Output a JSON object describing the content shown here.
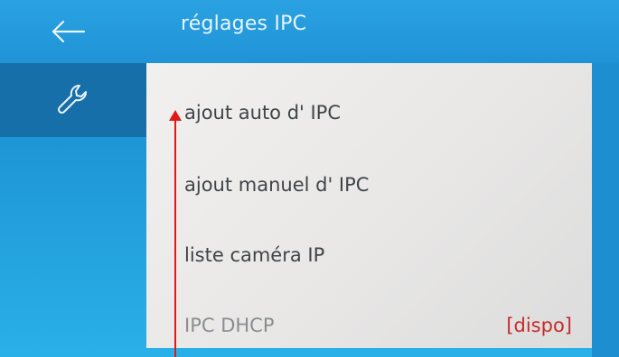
{
  "header": {
    "title": "réglages IPC",
    "back_icon": "arrow-left-icon"
  },
  "sidebar": {
    "items": [
      {
        "icon": "wrench-icon",
        "active": true
      }
    ]
  },
  "menu": {
    "items": [
      {
        "label": "ajout auto d' IPC"
      },
      {
        "label": "ajout manuel d' IPC"
      },
      {
        "label": "liste caméra IP"
      },
      {
        "label": "IPC DHCP",
        "value": "[dispo]"
      }
    ]
  },
  "colors": {
    "header_blue": "#2aa2e2",
    "sidebar_active": "#166fa8",
    "content_bg": "#eeedec",
    "value_red": "#c62a2a",
    "annotation_red": "#e01818"
  }
}
